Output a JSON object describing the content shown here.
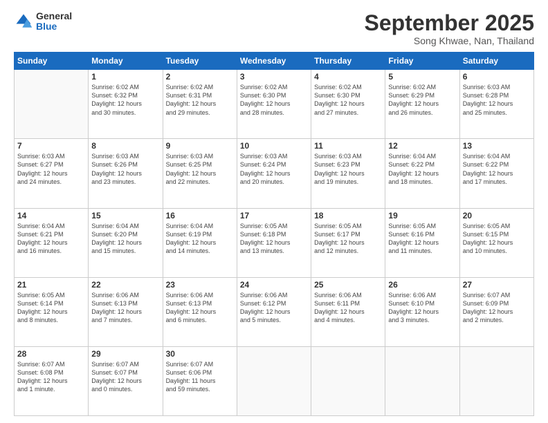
{
  "logo": {
    "general": "General",
    "blue": "Blue"
  },
  "header": {
    "month": "September 2025",
    "location": "Song Khwae, Nan, Thailand"
  },
  "weekdays": [
    "Sunday",
    "Monday",
    "Tuesday",
    "Wednesday",
    "Thursday",
    "Friday",
    "Saturday"
  ],
  "weeks": [
    [
      {
        "day": "",
        "info": ""
      },
      {
        "day": "1",
        "info": "Sunrise: 6:02 AM\nSunset: 6:32 PM\nDaylight: 12 hours\nand 30 minutes."
      },
      {
        "day": "2",
        "info": "Sunrise: 6:02 AM\nSunset: 6:31 PM\nDaylight: 12 hours\nand 29 minutes."
      },
      {
        "day": "3",
        "info": "Sunrise: 6:02 AM\nSunset: 6:30 PM\nDaylight: 12 hours\nand 28 minutes."
      },
      {
        "day": "4",
        "info": "Sunrise: 6:02 AM\nSunset: 6:30 PM\nDaylight: 12 hours\nand 27 minutes."
      },
      {
        "day": "5",
        "info": "Sunrise: 6:02 AM\nSunset: 6:29 PM\nDaylight: 12 hours\nand 26 minutes."
      },
      {
        "day": "6",
        "info": "Sunrise: 6:03 AM\nSunset: 6:28 PM\nDaylight: 12 hours\nand 25 minutes."
      }
    ],
    [
      {
        "day": "7",
        "info": "Sunrise: 6:03 AM\nSunset: 6:27 PM\nDaylight: 12 hours\nand 24 minutes."
      },
      {
        "day": "8",
        "info": "Sunrise: 6:03 AM\nSunset: 6:26 PM\nDaylight: 12 hours\nand 23 minutes."
      },
      {
        "day": "9",
        "info": "Sunrise: 6:03 AM\nSunset: 6:25 PM\nDaylight: 12 hours\nand 22 minutes."
      },
      {
        "day": "10",
        "info": "Sunrise: 6:03 AM\nSunset: 6:24 PM\nDaylight: 12 hours\nand 20 minutes."
      },
      {
        "day": "11",
        "info": "Sunrise: 6:03 AM\nSunset: 6:23 PM\nDaylight: 12 hours\nand 19 minutes."
      },
      {
        "day": "12",
        "info": "Sunrise: 6:04 AM\nSunset: 6:22 PM\nDaylight: 12 hours\nand 18 minutes."
      },
      {
        "day": "13",
        "info": "Sunrise: 6:04 AM\nSunset: 6:22 PM\nDaylight: 12 hours\nand 17 minutes."
      }
    ],
    [
      {
        "day": "14",
        "info": "Sunrise: 6:04 AM\nSunset: 6:21 PM\nDaylight: 12 hours\nand 16 minutes."
      },
      {
        "day": "15",
        "info": "Sunrise: 6:04 AM\nSunset: 6:20 PM\nDaylight: 12 hours\nand 15 minutes."
      },
      {
        "day": "16",
        "info": "Sunrise: 6:04 AM\nSunset: 6:19 PM\nDaylight: 12 hours\nand 14 minutes."
      },
      {
        "day": "17",
        "info": "Sunrise: 6:05 AM\nSunset: 6:18 PM\nDaylight: 12 hours\nand 13 minutes."
      },
      {
        "day": "18",
        "info": "Sunrise: 6:05 AM\nSunset: 6:17 PM\nDaylight: 12 hours\nand 12 minutes."
      },
      {
        "day": "19",
        "info": "Sunrise: 6:05 AM\nSunset: 6:16 PM\nDaylight: 12 hours\nand 11 minutes."
      },
      {
        "day": "20",
        "info": "Sunrise: 6:05 AM\nSunset: 6:15 PM\nDaylight: 12 hours\nand 10 minutes."
      }
    ],
    [
      {
        "day": "21",
        "info": "Sunrise: 6:05 AM\nSunset: 6:14 PM\nDaylight: 12 hours\nand 8 minutes."
      },
      {
        "day": "22",
        "info": "Sunrise: 6:06 AM\nSunset: 6:13 PM\nDaylight: 12 hours\nand 7 minutes."
      },
      {
        "day": "23",
        "info": "Sunrise: 6:06 AM\nSunset: 6:13 PM\nDaylight: 12 hours\nand 6 minutes."
      },
      {
        "day": "24",
        "info": "Sunrise: 6:06 AM\nSunset: 6:12 PM\nDaylight: 12 hours\nand 5 minutes."
      },
      {
        "day": "25",
        "info": "Sunrise: 6:06 AM\nSunset: 6:11 PM\nDaylight: 12 hours\nand 4 minutes."
      },
      {
        "day": "26",
        "info": "Sunrise: 6:06 AM\nSunset: 6:10 PM\nDaylight: 12 hours\nand 3 minutes."
      },
      {
        "day": "27",
        "info": "Sunrise: 6:07 AM\nSunset: 6:09 PM\nDaylight: 12 hours\nand 2 minutes."
      }
    ],
    [
      {
        "day": "28",
        "info": "Sunrise: 6:07 AM\nSunset: 6:08 PM\nDaylight: 12 hours\nand 1 minute."
      },
      {
        "day": "29",
        "info": "Sunrise: 6:07 AM\nSunset: 6:07 PM\nDaylight: 12 hours\nand 0 minutes."
      },
      {
        "day": "30",
        "info": "Sunrise: 6:07 AM\nSunset: 6:06 PM\nDaylight: 11 hours\nand 59 minutes."
      },
      {
        "day": "",
        "info": ""
      },
      {
        "day": "",
        "info": ""
      },
      {
        "day": "",
        "info": ""
      },
      {
        "day": "",
        "info": ""
      }
    ]
  ]
}
